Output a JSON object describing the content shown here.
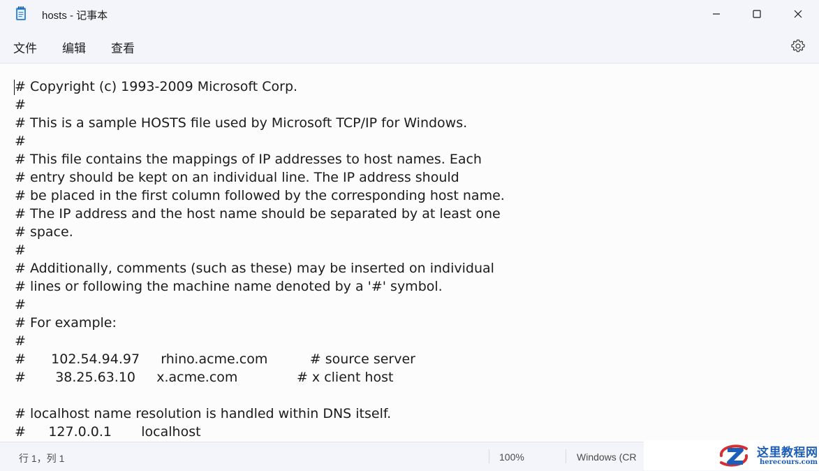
{
  "window": {
    "title": "hosts - 记事本"
  },
  "menu": {
    "file": "文件",
    "edit": "编辑",
    "view": "查看"
  },
  "editor": {
    "content": "# Copyright (c) 1993-2009 Microsoft Corp.\n#\n# This is a sample HOSTS file used by Microsoft TCP/IP for Windows.\n#\n# This file contains the mappings of IP addresses to host names. Each\n# entry should be kept on an individual line. The IP address should\n# be placed in the first column followed by the corresponding host name.\n# The IP address and the host name should be separated by at least one\n# space.\n#\n# Additionally, comments (such as these) may be inserted on individual\n# lines or following the machine name denoted by a '#' symbol.\n#\n# For example:\n#\n#      102.54.94.97     rhino.acme.com          # source server\n#       38.25.63.10     x.acme.com              # x client host\n\n# localhost name resolution is handled within DNS itself.\n#\t127.0.0.1       localhost"
  },
  "status": {
    "position": "行 1，列 1",
    "zoom": "100%",
    "line_ending": "Windows (CRLF)"
  },
  "watermark": {
    "title": "这里教程网",
    "url": "herecours.com"
  },
  "icons": {
    "app": "notepad-icon",
    "minimize": "minimize-icon",
    "maximize": "maximize-icon",
    "close": "close-icon",
    "settings": "gear-icon"
  },
  "colors": {
    "titlebar": "#eef1f6",
    "editor_bg": "#fcfcfc",
    "watermark_blue": "#1d5fb8",
    "watermark_red": "#d62f2f"
  }
}
